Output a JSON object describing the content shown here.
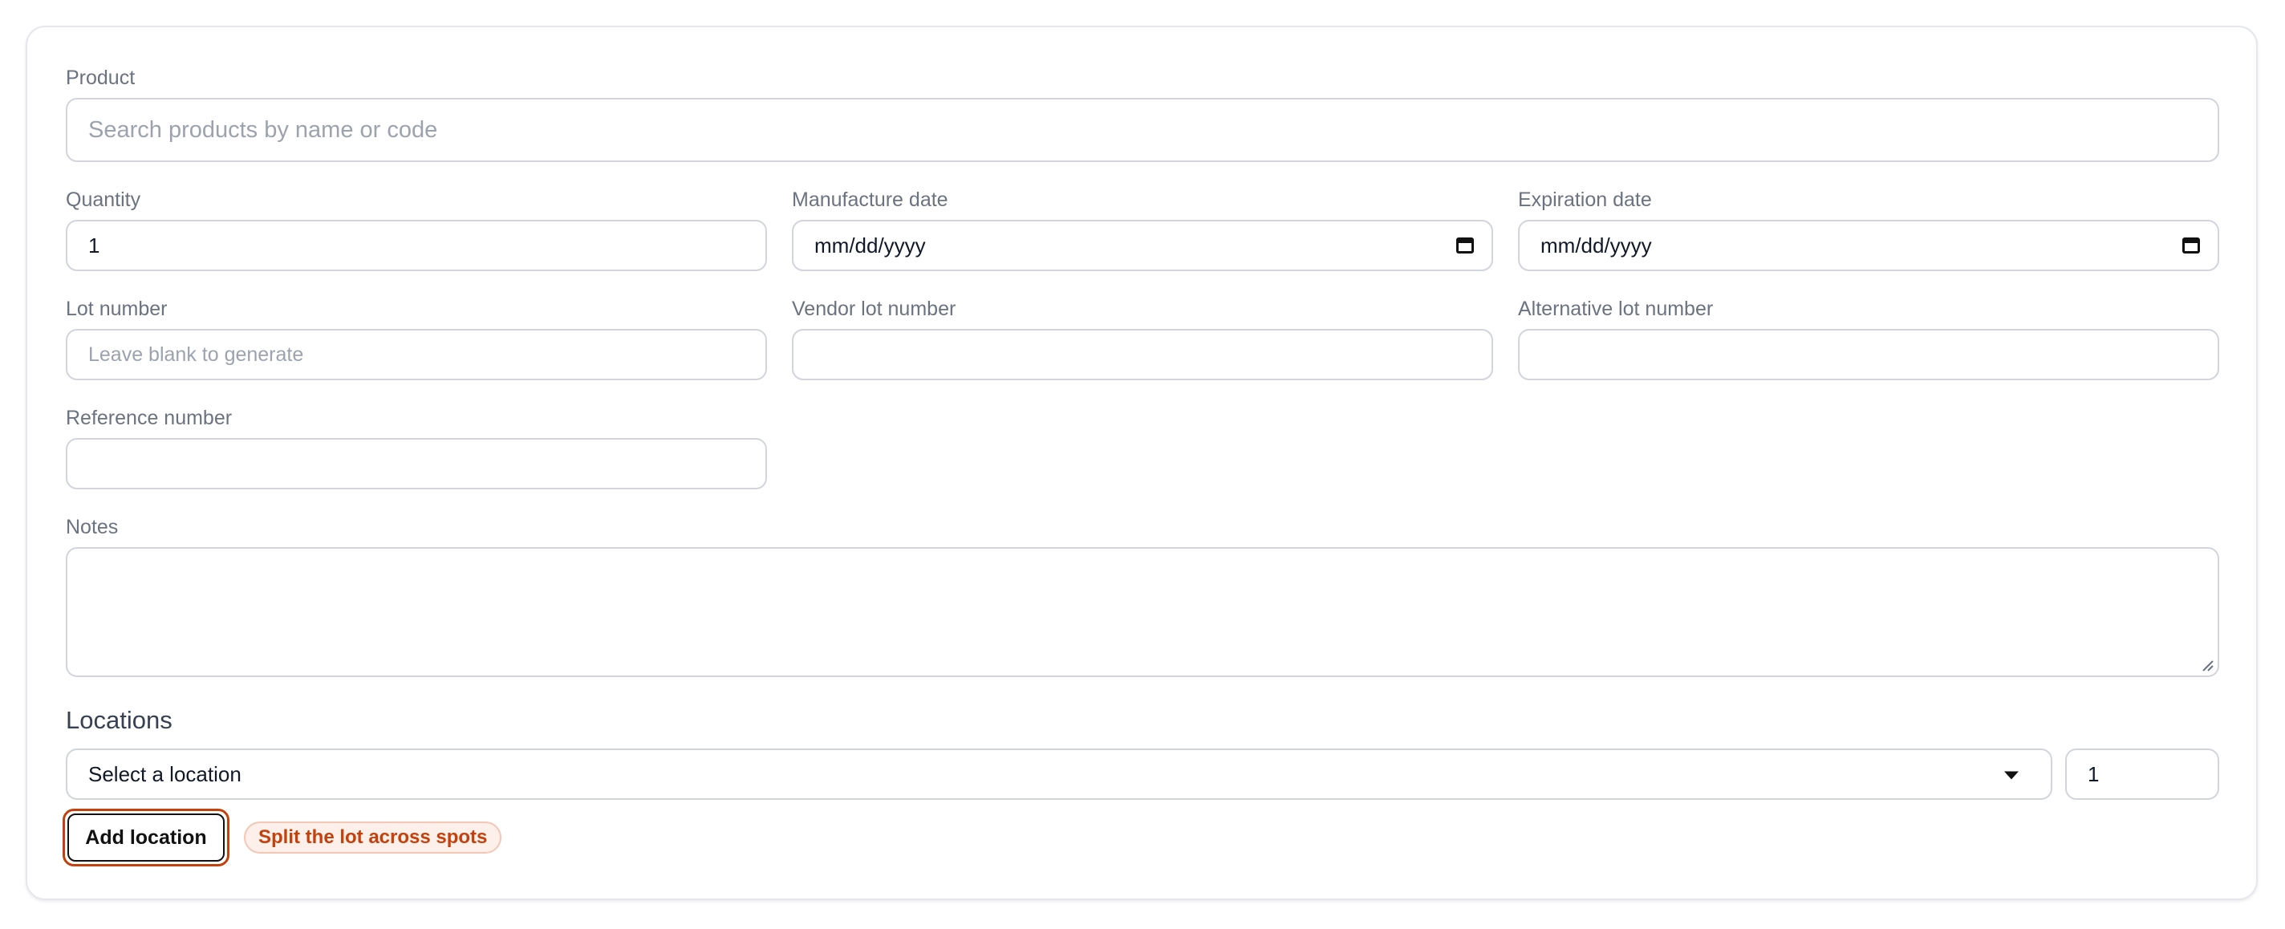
{
  "form": {
    "product": {
      "label": "Product",
      "placeholder": "Search products by name or code"
    },
    "quantity": {
      "label": "Quantity",
      "value": "1"
    },
    "manufacture_date": {
      "label": "Manufacture date",
      "placeholder": "mm/dd/yyyy"
    },
    "expiration_date": {
      "label": "Expiration date",
      "placeholder": "mm/dd/yyyy"
    },
    "lot_number": {
      "label": "Lot number",
      "placeholder": "Leave blank to generate"
    },
    "vendor_lot_number": {
      "label": "Vendor lot number",
      "value": ""
    },
    "alternative_lot_number": {
      "label": "Alternative lot number",
      "value": ""
    },
    "reference_number": {
      "label": "Reference number",
      "value": ""
    },
    "notes": {
      "label": "Notes",
      "value": ""
    }
  },
  "locations": {
    "title": "Locations",
    "select_value": "Select a location",
    "quantity_value": "1",
    "add_button_label": "Add location",
    "hint": "Split the lot across spots"
  },
  "icons": [
    "calendar-icon",
    "chevron-down-icon",
    "resize-grip-icon"
  ],
  "colors": {
    "accent": "#c2410c",
    "chip_bg": "#fdf0ea",
    "border": "#d1d5db"
  }
}
